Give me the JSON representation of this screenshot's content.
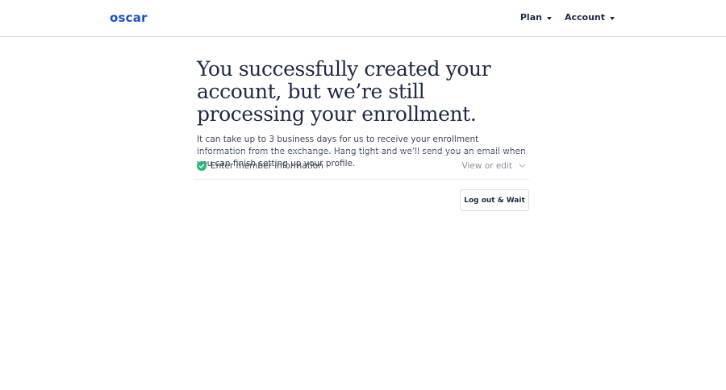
{
  "header": {
    "logo": "oscar",
    "nav": [
      {
        "label": "Plan"
      },
      {
        "label": "Account"
      }
    ]
  },
  "main": {
    "title": "You successfully created your account, but we’re still processing your enrollment.",
    "description": "It can take up to 3 business days for us to receive your enrollment information from the exchange. Hang tight and we’ll send you an email when you can finish setting up your profile.",
    "step": {
      "label": "Enter member information",
      "status": "complete",
      "action_label": "View or edit"
    },
    "logout_button": "Log out & Wait"
  },
  "colors": {
    "brand": "#1b4fd1",
    "text": "#1f2a44",
    "success": "#2fb87c",
    "muted": "#8a92a0"
  },
  "icons": [
    "check-circle-icon",
    "chevron-down-icon"
  ]
}
